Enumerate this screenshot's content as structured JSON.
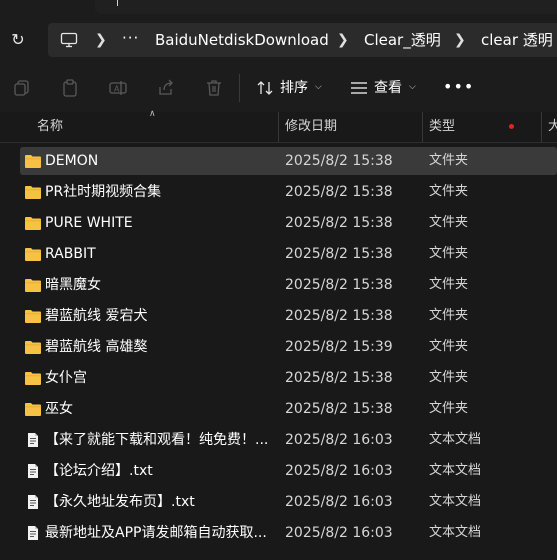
{
  "breadcrumb": {
    "overflow": "···",
    "items": [
      "BaiduNetdiskDownload",
      "Clear_透明",
      "clear 透明"
    ]
  },
  "toolbar": {
    "sort_label": "排序",
    "view_label": "查看",
    "more_label": "•••",
    "icons": [
      "copy-icon",
      "paste-icon",
      "rename-icon",
      "share-icon",
      "delete-icon"
    ]
  },
  "columns": {
    "name": "名称",
    "date": "修改日期",
    "type": "类型",
    "size": "大"
  },
  "colors": {
    "folder": "#f6c244",
    "selected_row": "#3a3a3a",
    "sort_dot": "#e02424"
  },
  "files": [
    {
      "name": "DEMON",
      "date": "2025/8/2 15:38",
      "type": "文件夹",
      "kind": "folder",
      "selected": true
    },
    {
      "name": "PR社时期视频合集",
      "date": "2025/8/2 15:38",
      "type": "文件夹",
      "kind": "folder"
    },
    {
      "name": "PURE WHITE",
      "date": "2025/8/2 15:38",
      "type": "文件夹",
      "kind": "folder"
    },
    {
      "name": "RABBIT",
      "date": "2025/8/2 15:38",
      "type": "文件夹",
      "kind": "folder"
    },
    {
      "name": "暗黑魔女",
      "date": "2025/8/2 15:38",
      "type": "文件夹",
      "kind": "folder"
    },
    {
      "name": "碧蓝航线 爱宕犬",
      "date": "2025/8/2 15:38",
      "type": "文件夹",
      "kind": "folder"
    },
    {
      "name": "碧蓝航线 高雄獒",
      "date": "2025/8/2 15:39",
      "type": "文件夹",
      "kind": "folder"
    },
    {
      "name": "女仆宫",
      "date": "2025/8/2 15:38",
      "type": "文件夹",
      "kind": "folder"
    },
    {
      "name": "巫女",
      "date": "2025/8/2 15:38",
      "type": "文件夹",
      "kind": "folder"
    },
    {
      "name": "【来了就能下载和观看！纯免费！...",
      "date": "2025/8/2 16:03",
      "type": "文本文档",
      "kind": "text"
    },
    {
      "name": "【论坛介绍】.txt",
      "date": "2025/8/2 16:03",
      "type": "文本文档",
      "kind": "text"
    },
    {
      "name": "【永久地址发布页】.txt",
      "date": "2025/8/2 16:03",
      "type": "文本文档",
      "kind": "text"
    },
    {
      "name": "最新地址及APP请发邮箱自动获取...",
      "date": "2025/8/2 16:03",
      "type": "文本文档",
      "kind": "text"
    }
  ]
}
